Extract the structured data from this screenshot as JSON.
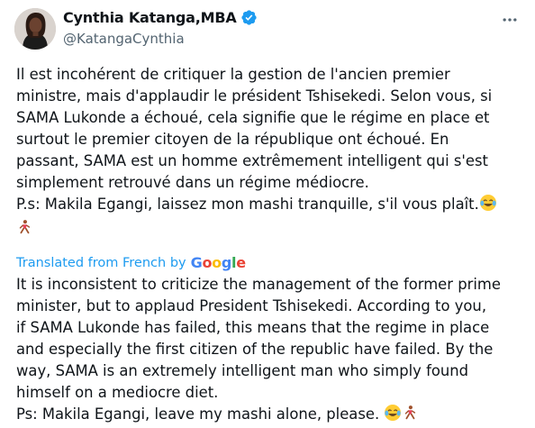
{
  "author": {
    "display_name": "Cynthia Katanga,MBA",
    "handle": "@KatangaCynthia",
    "verified": true,
    "avatar_icon": "profile-photo-avatar"
  },
  "menu": {
    "icon": "more-horizontal-icon"
  },
  "tweet": {
    "original_text": "Il est incohérent de critiquer la gestion de l'ancien premier\nministre, mais d'applaudir le président Tshisekedi. Selon vous, si\nSAMA Lukonde a échoué, cela signifie que le régime en place et\nsurtout le premier citoyen de la république ont échoué. En\npassant, SAMA est un homme extrêmement intelligent qui s'est\nsimplement retrouvé dans un régime médiocre.\nP.s: Makila Egangi, laissez mon mashi tranquille, s'il vous plaît.",
    "translated_label": "Translated from French by",
    "translator_brand": [
      "G",
      "o",
      "o",
      "g",
      "l",
      "e"
    ],
    "translator_brand_colors": [
      "#4285F4",
      "#EA4335",
      "#FBBC05",
      "#4285F4",
      "#34A853",
      "#EA4335"
    ],
    "translated_text": "It is inconsistent to criticize the management of the former prime\nminister, but to applaud President Tshisekedi. According to you,\nif SAMA Lukonde has failed, this means that the regime in place\nand especially the first citizen of the republic have failed. By the\nway, SAMA is an extremely intelligent man who simply found\nhimself on a mediocre diet.\nPs: Makila Egangi, leave my mashi alone, please."
  },
  "colors": {
    "text": "#0f1419",
    "secondary": "#536471",
    "link": "#1d9bf0",
    "verified": "#1d9bf0"
  }
}
